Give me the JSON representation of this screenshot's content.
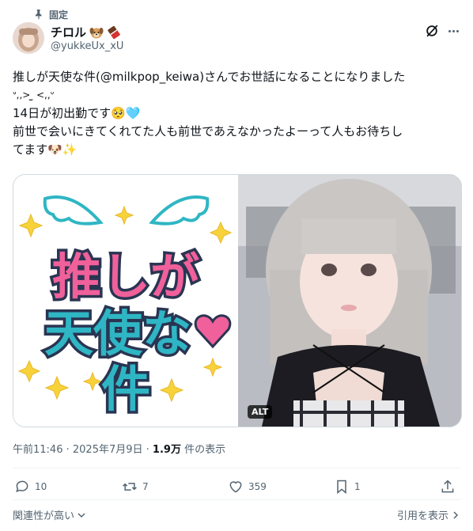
{
  "pinned": {
    "label": "固定",
    "icon": "pin-icon"
  },
  "author": {
    "display_name": "チロル",
    "name_emojis": [
      "dog-face-emoji",
      "chocolate-bar-emoji"
    ],
    "handle": "@yukkeUx_xU"
  },
  "tweet": {
    "lines": [
      "推しが天使な件(@milkpop_keiwa)さんでお世話になることになりました",
      "ᐡ,,> ̫ <,,ᐡ",
      "14日が初出勤です🥺🩵",
      "前世で会いにきてくれてた人も前世であえなかったよーって人もお待ちし",
      "てます🐶✨"
    ]
  },
  "media": {
    "logo_text": [
      "推しが",
      "天使な",
      "件"
    ],
    "alt_badge": "ALT",
    "colors": {
      "pink": "#f0609a",
      "teal": "#2fb6c4",
      "yellow": "#f7d23a"
    }
  },
  "meta": {
    "time": "午前11:46",
    "date": "2025年7月9日",
    "views": "1.9万",
    "views_label": "件の表示"
  },
  "actions": {
    "replies": "10",
    "reposts": "7",
    "likes": "359",
    "bookmarks": "1"
  },
  "footer": {
    "relevance": "関連性が高い",
    "quotes": "引用を表示"
  },
  "colors": {
    "muted": "#536471",
    "text": "#0f1419",
    "border": "#cfd9de"
  }
}
